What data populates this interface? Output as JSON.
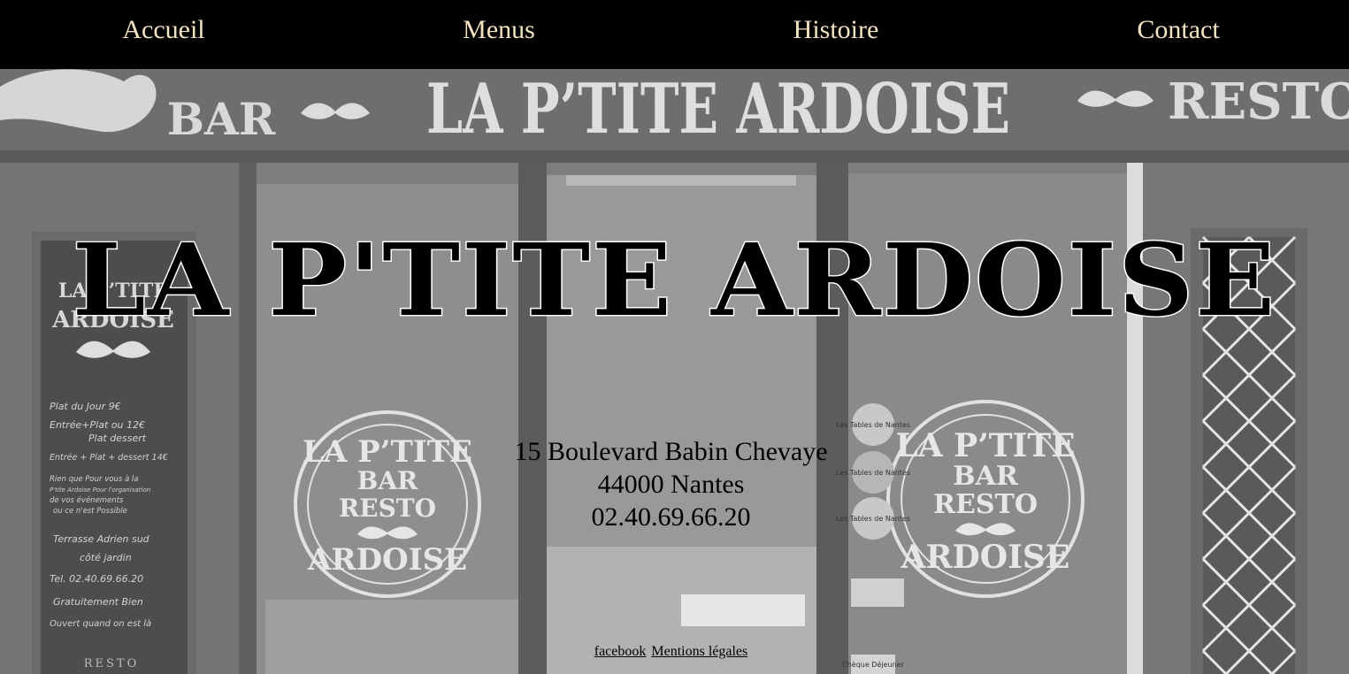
{
  "nav": {
    "items": [
      {
        "label": "Accueil"
      },
      {
        "label": "Menus"
      },
      {
        "label": "Histoire"
      },
      {
        "label": "Contact"
      }
    ]
  },
  "hero": {
    "title": "LA P'TITE ARDOISE",
    "sign": {
      "bar": "BAR",
      "name": "LA P’TITE ARDOISE",
      "resto": "RESTO"
    },
    "window_logo": {
      "top": "LA P’TITE",
      "line1": "BAR",
      "line2": "RESTO",
      "bottom": "ARDOISE"
    },
    "chalkboard": {
      "header_top": "LA P’TITE",
      "header_bottom": "ARDOISE",
      "lines": [
        "Plat du Jour  9€",
        "Entrée+Plat ou  12€",
        "Plat dessert",
        "Entrée + Plat + dessert 14€",
        "Rien que Pour vous à la",
        "P'tite Ardoise Pour l'organisation",
        "de vos événements",
        "ou ce n'est Possible",
        "Terrasse Adrien sud",
        "côté jardin",
        "Tel. 02.40.69.66.20",
        "Gratuitement Bien",
        "Ouvert quand on est là"
      ],
      "footer": "RESTO"
    },
    "stickers": [
      "Les Tables de Nantes",
      "Les Tables de Nantes",
      "Les Tables de Nantes",
      "Chèque Déjeuner"
    ]
  },
  "address": {
    "street": "15 Boulevard Babin Chevaye",
    "city": "44000 Nantes",
    "phone": "02.40.69.66.20"
  },
  "footer": {
    "facebook": "facebook",
    "legal": "Mentions légales"
  },
  "colors": {
    "nav_bg": "#000000",
    "nav_text": "#f3e3c3"
  }
}
